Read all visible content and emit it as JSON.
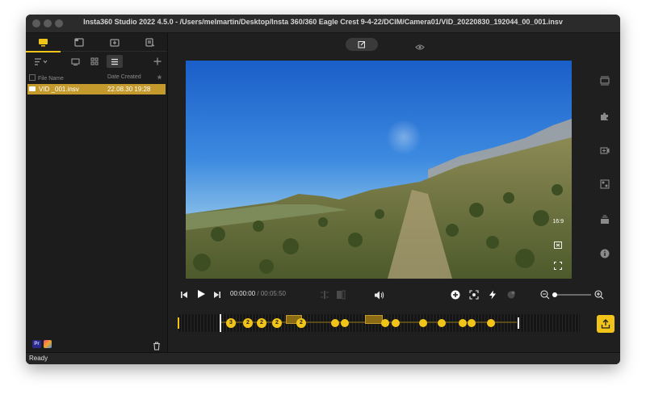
{
  "window": {
    "title": "Insta360 Studio 2022 4.5.0 - /Users/melmartin/Desktop/Insta 360/360 Eagle Crest 9-4-22/DCIM/Camera01/VID_20220830_192044_00_001.insv"
  },
  "sidebar": {
    "tabs": [
      {
        "icon": "media-library-icon"
      },
      {
        "icon": "album-icon"
      },
      {
        "icon": "import-icon"
      },
      {
        "icon": "tasks-icon"
      }
    ],
    "active_tab": 0,
    "columns": {
      "name": "File Name",
      "date": "Date Created"
    },
    "files": [
      {
        "name": "VID _001.insv",
        "date": "22.08.30 19:28"
      }
    ]
  },
  "player": {
    "aspect_ratio": "16:9",
    "current_time": "00:00:00",
    "separator": "/",
    "duration": "00:05:50"
  },
  "timeline": {
    "markers": [
      "3",
      "2",
      "2",
      "2",
      "2",
      "",
      "",
      "",
      "",
      "",
      "",
      "",
      "",
      "",
      ""
    ]
  },
  "status": {
    "text": "Ready"
  },
  "colors": {
    "accent": "#f0c419",
    "selection": "#c49a2c"
  }
}
